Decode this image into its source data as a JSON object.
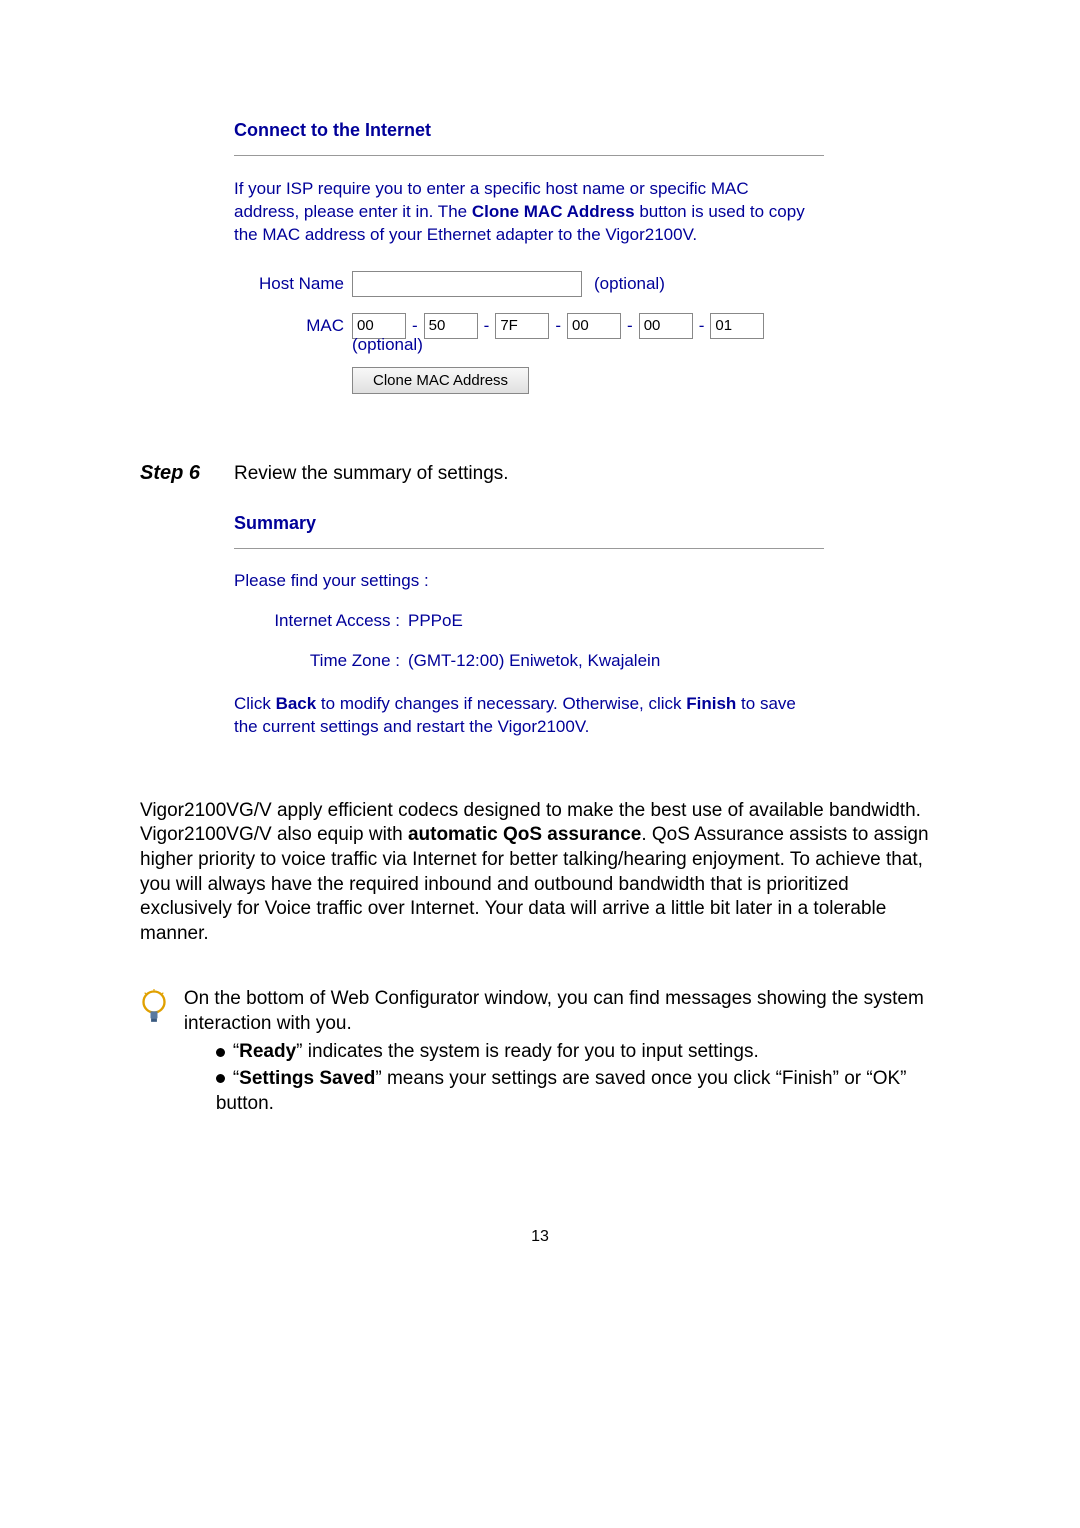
{
  "connect": {
    "title": "Connect to the Internet",
    "intro_a": "If your ISP require you to enter a specific host name or specific MAC address, please enter it in. The ",
    "intro_bold": "Clone MAC Address",
    "intro_b": " button is used to copy the MAC address of your Ethernet adapter to the Vigor2100V.",
    "host_label": "Host Name",
    "host_value": "",
    "optional": "(optional)",
    "mac_label": "MAC",
    "mac": [
      "00",
      "50",
      "7F",
      "00",
      "00",
      "01"
    ],
    "clone_btn": "Clone MAC Address"
  },
  "step6": {
    "label": "Step 6",
    "text": "Review the summary of settings."
  },
  "summary": {
    "title": "Summary",
    "find": "Please find your settings :",
    "ia_label": "Internet Access :",
    "ia_value": "PPPoE",
    "tz_label": "Time Zone :",
    "tz_value": "(GMT-12:00) Eniwetok, Kwajalein",
    "note_a": "Click ",
    "note_back": "Back",
    "note_b": " to modify changes if necessary. Otherwise, click ",
    "note_finish": "Finish",
    "note_c": " to save the current settings and restart the Vigor2100V."
  },
  "qos": {
    "a": "Vigor2100VG/V apply efficient codecs designed to make the best use of available bandwidth. Vigor2100VG/V also equip with ",
    "b_bold": "automatic QoS assurance",
    "c": ".    QoS Assurance assists to assign higher priority to voice traffic via Internet for better talking/hearing enjoyment. To achieve that, you will always have the required inbound and outbound bandwidth that is prioritized exclusively for Voice traffic over Internet.    Your data will arrive a little bit later in a tolerable manner."
  },
  "tip": {
    "lead": "On the bottom of Web Configurator window, you can find messages showing the system interaction with you.",
    "b1_q1": "“",
    "b1_bold": "Ready",
    "b1_rest": "” indicates the system is ready for you to input settings.",
    "b2_q1": "“",
    "b2_bold": "Settings Saved",
    "b2_rest": "” means your settings are saved once you click “Finish” or “OK” button."
  },
  "page_number": "13"
}
